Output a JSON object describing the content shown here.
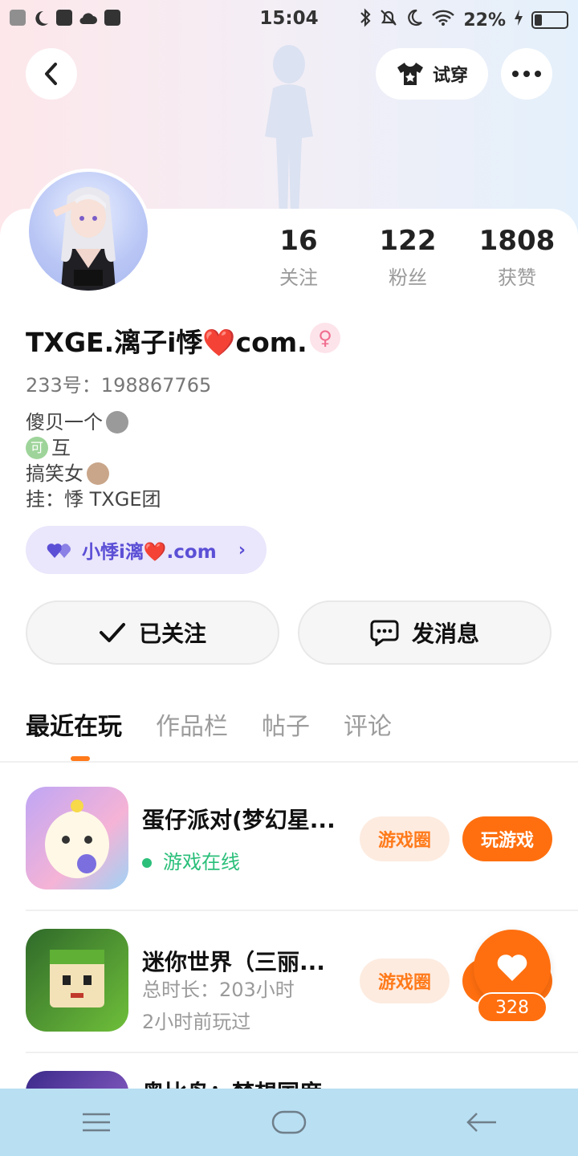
{
  "status_bar": {
    "time": "15:04",
    "battery": "22%"
  },
  "header": {
    "try_on_label": "试穿"
  },
  "profile": {
    "stats": [
      {
        "value": "16",
        "label": "关注"
      },
      {
        "value": "122",
        "label": "粉丝"
      },
      {
        "value": "1808",
        "label": "获赞"
      }
    ],
    "nickname": "TXGE.漓子i悸❤️com.",
    "gender_symbol": "♀",
    "uid": "233号：198867765",
    "bio": {
      "line1": "傻贝一个",
      "line2": "互",
      "line3": "搞笑女",
      "line4": "挂：悸   TXGE团"
    },
    "tag_label": "小悸i漓❤️.com",
    "follow_button": "已关注",
    "message_button": "发消息"
  },
  "tabs": [
    "最近在玩",
    "作品栏",
    "帖子",
    "评论"
  ],
  "games": [
    {
      "name": "蛋仔派对(梦幻星...",
      "status": "游戏在线",
      "circle_label": "游戏圈",
      "play_label": "玩游戏"
    },
    {
      "name": "迷你世界（三丽...",
      "duration": "总时长：203小时",
      "last_played": "2小时前玩过",
      "circle_label": "游戏圈"
    },
    {
      "name": "奥比岛：梦想国度"
    }
  ],
  "like_count": "328",
  "colors": {
    "accent": "#ff6f0f",
    "online": "#2bbf7a",
    "tag": "#5b4fd6"
  }
}
